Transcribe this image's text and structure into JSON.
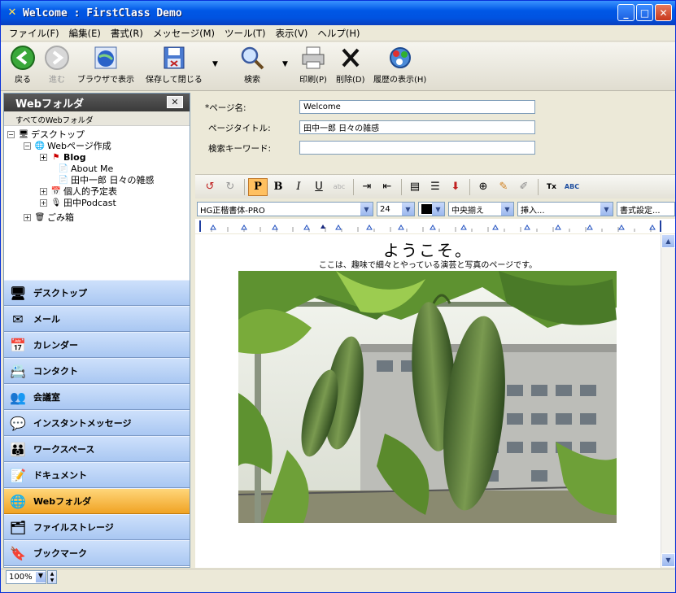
{
  "window": {
    "title": "Welcome : FirstClass Demo"
  },
  "menu": [
    "ファイル(F)",
    "編集(E)",
    "書式(R)",
    "メッセージ(M)",
    "ツール(T)",
    "表示(V)",
    "ヘルプ(H)"
  ],
  "toolbar": {
    "back": "戻る",
    "forward": "進む",
    "browser_view": "ブラウザで表示",
    "save_close": "保存して閉じる",
    "search": "検索",
    "print": "印刷(P)",
    "delete": "削除(D)",
    "history": "履歴の表示(H)"
  },
  "left_pane": {
    "title": "Webフォルダ",
    "subtitle": "すべてのWebフォルダ",
    "tree": {
      "desktop": "デスクトップ",
      "web_create": "Webページ作成",
      "blog": "Blog",
      "about": "About Me",
      "diary": "田中一郎 日々の雑感",
      "schedule": "個人的予定表",
      "podcast": "田中Podcast",
      "trash": "ごみ箱"
    },
    "nav": [
      "デスクトップ",
      "メール",
      "カレンダー",
      "コンタクト",
      "会議室",
      "インスタントメッセージ",
      "ワークスペース",
      "ドキュメント",
      "Webフォルダ",
      "ファイルストレージ",
      "ブックマーク"
    ],
    "nav_active": "Webフォルダ"
  },
  "form": {
    "page_name_label": "*ページ名:",
    "page_name_value": "Welcome",
    "page_title_label": "ページタイトル:",
    "page_title_value": "田中一郎 日々の雑感",
    "keyword_label": "検索キーワード:",
    "keyword_value": ""
  },
  "format": {
    "font": "HG正楷書体-PRO",
    "size": "24",
    "align": "中央揃え",
    "insert": "挿入...",
    "style_settings": "書式設定..."
  },
  "editor": {
    "heading": "ようこそ。",
    "subheading": "ここは、趣味で細々とやっている演芸と写真のページです。"
  },
  "status": {
    "zoom": "100%"
  },
  "colors": {
    "accent": "#0058e6",
    "nav": "#a9c7f2",
    "active": "#f0a324"
  }
}
